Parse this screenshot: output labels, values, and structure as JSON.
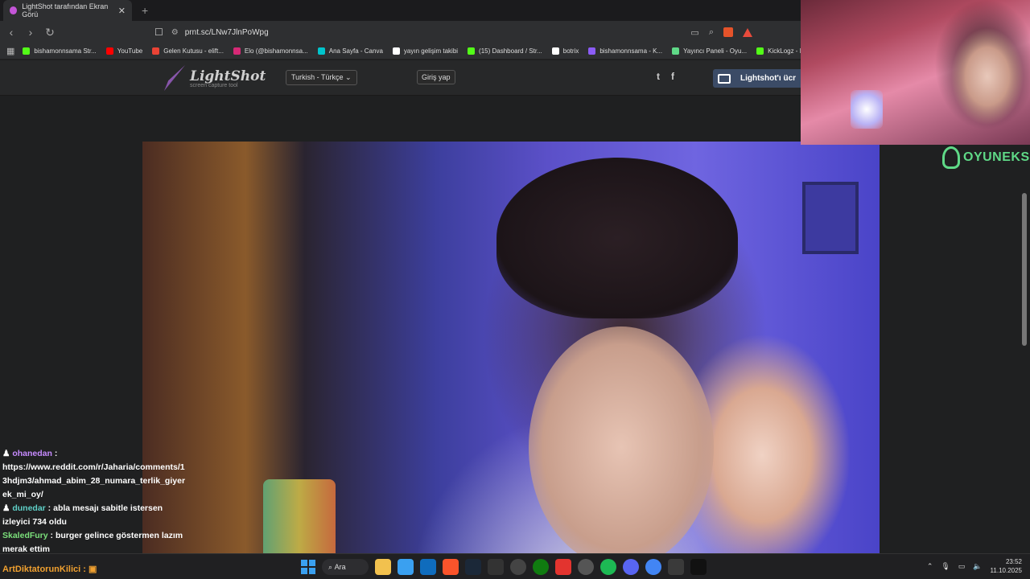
{
  "browser": {
    "tab": {
      "title": "LightShot tarafından Ekran Görü",
      "close": "✕"
    },
    "new_tab": "+",
    "nav": {
      "back": "‹",
      "forward": "›",
      "reload": "↻"
    },
    "bookmark_icon": "☐",
    "url": "prnt.sc/LNw7JlnPoWpg",
    "bookmarks": [
      {
        "label": "bishamonnsama Str...",
        "color": "#53fc18"
      },
      {
        "label": "YouTube",
        "color": "#ff0000"
      },
      {
        "label": "Gelen Kutusu - elift...",
        "color": "#ea4335"
      },
      {
        "label": "Elo (@bishamonnsa...",
        "color": "#d62976"
      },
      {
        "label": "Ana Sayfa - Canva",
        "color": "#00c4cc"
      },
      {
        "label": "yayın gelişim takibi",
        "color": "#ffffff"
      },
      {
        "label": "(15) Dashboard / Str...",
        "color": "#53fc18"
      },
      {
        "label": "botrix",
        "color": "#ffffff"
      },
      {
        "label": "bishamonnsama - K...",
        "color": "#8b5cf6"
      },
      {
        "label": "Yayıncı Paneli - Oyu...",
        "color": "#5fd987"
      },
      {
        "label": "KickLogz - K",
        "color": "#53fc18"
      }
    ]
  },
  "lightshot": {
    "name": "LightShot",
    "tagline": "screen capture tool",
    "language": "Turkish - Türkçe",
    "login": "Giriş yap",
    "twitter": "t",
    "facebook": "f",
    "cta": "Lightshot'ı ücr"
  },
  "overlay": {
    "brand": "OYUNEKS"
  },
  "chat": [
    {
      "user": "ohanedan",
      "color": "#c78bff",
      "text": "",
      "badge": "♟"
    },
    {
      "user": "",
      "color": "#ffffff",
      "text": "https://www.reddit.com/r/Jaharia/comments/13hdjm3/ahmad_abim_28_numara_terlik_giyerek_mi_oy/",
      "badge": ""
    },
    {
      "user": "dunedar",
      "color": "#5fd0c8",
      "text": "abla mesajı sabitle istersen izleyici 734 oldu",
      "badge": "♟"
    },
    {
      "user": "SkaledFury",
      "color": "#7be07b",
      "text": "burger gelince göstermen lazım merak ettim",
      "badge": ""
    },
    {
      "user": "ArtDiktatorunKilici",
      "color": "#f0a030",
      "text": "",
      "badge": ""
    }
  ],
  "taskbar": {
    "search": "Ara",
    "time": "23:52",
    "date": "11.10.2025",
    "pinned": [
      {
        "name": "file-explorer",
        "color": "#f2c14e"
      },
      {
        "name": "store",
        "color": "#3aa0f0"
      },
      {
        "name": "outlook",
        "color": "#0f6cbd"
      },
      {
        "name": "brave",
        "color": "#fb542b"
      },
      {
        "name": "steam",
        "color": "#1b2838"
      },
      {
        "name": "epic",
        "color": "#333333"
      },
      {
        "name": "obs",
        "color": "#444444"
      },
      {
        "name": "xbox",
        "color": "#107c10"
      },
      {
        "name": "app-red",
        "color": "#e3342f"
      },
      {
        "name": "chrome-beta",
        "color": "#555555"
      },
      {
        "name": "spotify",
        "color": "#1db954"
      },
      {
        "name": "discord",
        "color": "#5865f2"
      },
      {
        "name": "chrome",
        "color": "#4285f4"
      },
      {
        "name": "davinci",
        "color": "#3a3a3a"
      },
      {
        "name": "capcut",
        "color": "#111111"
      }
    ]
  }
}
